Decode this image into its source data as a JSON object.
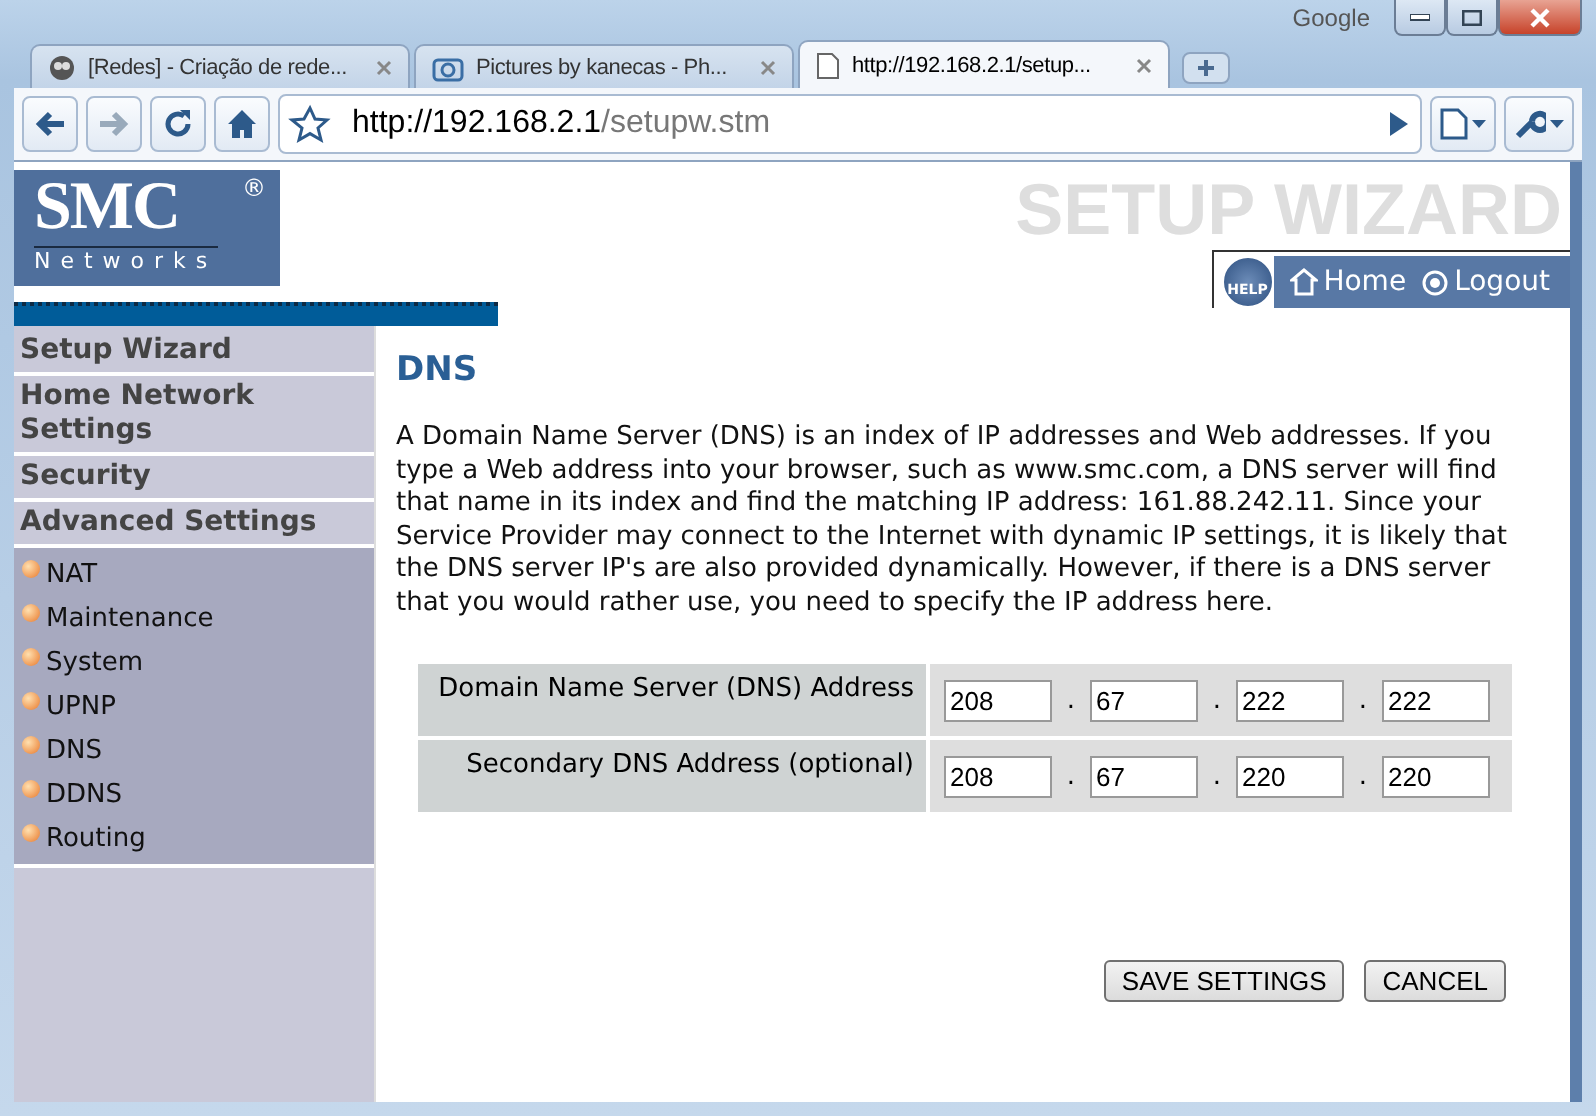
{
  "browser": {
    "brand": "Google",
    "tabs": [
      {
        "title": "[Redes] - Criação de rede...",
        "selected": false
      },
      {
        "title": "Pictures by kanecas - Ph...",
        "selected": false
      },
      {
        "title": "http://192.168.2.1/setup...",
        "selected": true
      }
    ],
    "url_host": "http://192.168.2.1",
    "url_path": "/setupw.stm"
  },
  "header": {
    "logo": "SMC",
    "logo_mark": "®",
    "logo_sub": "Networks",
    "title": "SETUP WIZARD",
    "help": "HELP",
    "links": [
      "Home",
      "Logout"
    ]
  },
  "sidebar": {
    "items": [
      {
        "label": "Setup Wizard"
      },
      {
        "label": "Home Network Settings"
      },
      {
        "label": "Security"
      },
      {
        "label": "Advanced Settings",
        "children": [
          {
            "label": "NAT"
          },
          {
            "label": "Maintenance"
          },
          {
            "label": "System"
          },
          {
            "label": "UPNP"
          },
          {
            "label": "DNS"
          },
          {
            "label": "DDNS"
          },
          {
            "label": "Routing"
          }
        ]
      }
    ]
  },
  "content": {
    "heading": "DNS",
    "description": "A Domain Name Server (DNS) is an index of IP addresses and Web addresses. If you type a Web address into your browser, such as www.smc.com, a DNS server will find that name in its index and find the matching IP address: 161.88.242.11. Since your Service Provider may connect to the Internet with dynamic IP settings, it is likely that the DNS server IP's are also provided dynamically. However, if there is a DNS server that you would rather use, you need to specify the IP address here.",
    "fields": [
      {
        "label": "Domain Name Server (DNS) Address",
        "separator": ".",
        "octets": [
          "208",
          "67",
          "222",
          "222"
        ]
      },
      {
        "label": "Secondary DNS Address (optional)",
        "separator": ".",
        "octets": [
          "208",
          "67",
          "220",
          "220"
        ]
      }
    ],
    "buttons": [
      "SAVE SETTINGS",
      "CANCEL"
    ]
  }
}
